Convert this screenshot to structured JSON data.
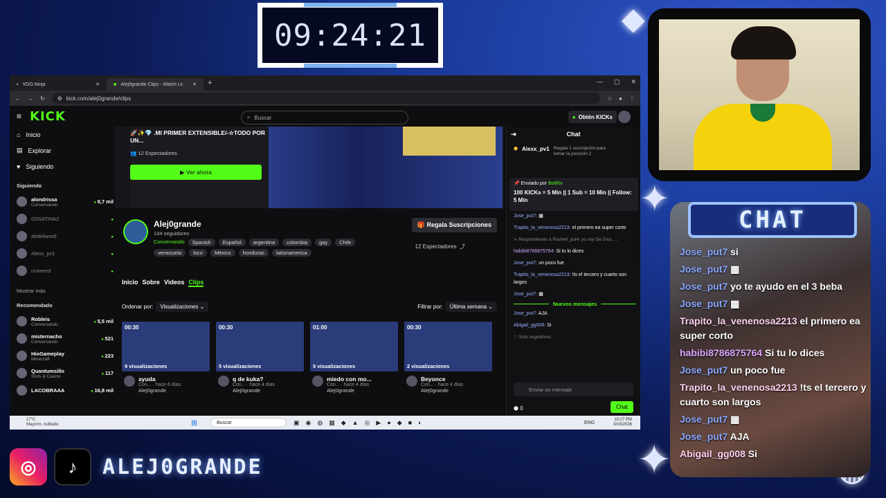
{
  "overlay": {
    "timer": "09:24:21",
    "chat_title": "CHAT",
    "brand": "ALEJ0GRANDE",
    "messages": [
      {
        "user": "Jose_put7",
        "text": "si",
        "cls": "u"
      },
      {
        "user": "Jose_put7",
        "text": "",
        "cls": "u"
      },
      {
        "user": "Jose_put7",
        "text": "yo te ayudo en el 3 beba",
        "cls": "u"
      },
      {
        "user": "Jose_put7",
        "text": "",
        "cls": "u"
      },
      {
        "user": "Trapito_la_venenosa2213",
        "text": "el primero ea super corto",
        "cls": "u3"
      },
      {
        "user": "habibi8786875764",
        "text": "Si tu lo dices",
        "cls": "u2"
      },
      {
        "user": "Jose_put7",
        "text": "un poco fue",
        "cls": "u"
      },
      {
        "user": "Trapito_la_venenosa2213",
        "text": "!ts el tercero y cuarto son largos",
        "cls": "u3"
      },
      {
        "user": "Jose_put7",
        "text": "",
        "cls": "u"
      },
      {
        "user": "Jose_put7",
        "text": "AJA",
        "cls": "u"
      },
      {
        "user": "Abigail_gg008",
        "text": "Si",
        "cls": "u3"
      }
    ]
  },
  "browser": {
    "tab1": "VDO.Ninja",
    "tab2": "Alej0grande Clips - Watch Live on Kick",
    "url": "kick.com/alej0grande/clips"
  },
  "kick": {
    "logo": "KICK",
    "search": "Buscar",
    "kicks_btn": "Obtén KICKs",
    "nav": [
      "Inicio",
      "Explorar",
      "Siguiendo"
    ],
    "following_title": "Siguiendo",
    "following": [
      {
        "name": "alondrissa",
        "sub": "Conversando",
        "count": "9,7 mil",
        "on": true
      },
      {
        "name": "D3SATINA2",
        "sub": "",
        "count": "",
        "on": false
      },
      {
        "name": "abdeliano5",
        "sub": "",
        "count": "",
        "on": false
      },
      {
        "name": "Alexx_pv1",
        "sub": "",
        "count": "",
        "on": false
      },
      {
        "name": "rruneerd",
        "sub": "",
        "count": "",
        "on": false
      }
    ],
    "show_more": "Mostrar más",
    "recommended_title": "Recomendado",
    "recommended": [
      {
        "name": "Robleis",
        "sub": "Conversando",
        "count": "5,5 mil"
      },
      {
        "name": "misternacho",
        "sub": "Conversando",
        "count": "521"
      },
      {
        "name": "HioGameplay",
        "sub": "Minecraft",
        "count": "223"
      },
      {
        "name": "Quantumsillo",
        "sub": "Slots & Casino",
        "count": "117"
      },
      {
        "name": "LACOBRAAA",
        "sub": "",
        "count": "16,8 mil"
      }
    ],
    "hero": {
      "title": "🚀✨💎 .MI PRIMER EXTENSIBLE/-☆TODO POR UN...",
      "viewers": "12 Espectadores",
      "watch": "Ver ahora"
    },
    "profile": {
      "name": "Alej0grande",
      "followers": "134 seguidores",
      "category": "Conversando",
      "tags": [
        "Spanish",
        "Español",
        "argentina",
        "colombia",
        "gay",
        "Chile",
        "venezuela",
        "loco",
        "México",
        "honduras",
        "lationamerica"
      ],
      "gift": "Regala Suscripciones",
      "viewers": "12 Espectadores",
      "live": "LIVE"
    },
    "tabs": [
      "Inicio",
      "Sobre",
      "Videos",
      "Clips"
    ],
    "sort_label": "Ordenar por:",
    "sort_value": "Visualizaciones",
    "filter_label": "Filtrar por:",
    "filter_value": "Última semana",
    "clips": [
      {
        "dur": "00:30",
        "views": "9 visualizaciones",
        "title": "ayuda",
        "meta": "Con... · hace 6 días",
        "author": "Alej0grande"
      },
      {
        "dur": "00:30",
        "views": "5 visualizaciones",
        "title": "q de kuka?",
        "meta": "Con... · hace 4 días",
        "author": "Alej0grande"
      },
      {
        "dur": "01:00",
        "views": "5 visualizaciones",
        "title": "miedo con mo...",
        "meta": "Con... · hace 4 días",
        "author": "Alej0grande"
      },
      {
        "dur": "00:30",
        "views": "2 visualizaciones",
        "title": "Beyonce",
        "meta": "Con... · hace 4 días",
        "author": "Alej0grande"
      }
    ],
    "chat": {
      "title": "Chat",
      "top_user": "Aiexx_pv1",
      "top_note": "Regala 1 suscripción para tomar la posición 2",
      "pin_by": "Enviado por",
      "pin_bot": "BotRix",
      "pin_text": "100 KICKs = 5 Min || 1 Sub = 10 Min || Follow: 5 Min",
      "msgs": [
        {
          "u": "Jose_put7",
          "t": ""
        },
        {
          "u": "Trapito_la_venenosa2213",
          "t": "el primero ea super corto"
        },
        {
          "u": "",
          "t": "Respondiendo a Rachell_put4: yo soy De Dios, ..."
        },
        {
          "u": "habibi8786875764",
          "t": "Si tu lo dices"
        },
        {
          "u": "Jose_put7",
          "t": "un poco fue"
        },
        {
          "u": "Trapito_la_venenosa2213",
          "t": "!ts el tercero y cuarto son largos"
        },
        {
          "u": "Jose_put7",
          "t": ""
        }
      ],
      "new": "Nuevos mensajes",
      "msgs2": [
        {
          "u": "Jose_put7",
          "t": "AJA"
        },
        {
          "u": "Abigail_gg008",
          "t": "Si"
        }
      ],
      "only_followers": "Solo seguidores",
      "input": "Enviar un mensaje",
      "chat_btn": "Chat",
      "kicks_count": "0"
    }
  },
  "taskbar": {
    "search": "Buscar",
    "weather": "17°C",
    "weather2": "Mayorm. nublado",
    "time": "10:27 PM",
    "date": "3/15/2026",
    "lang": "ENG"
  }
}
